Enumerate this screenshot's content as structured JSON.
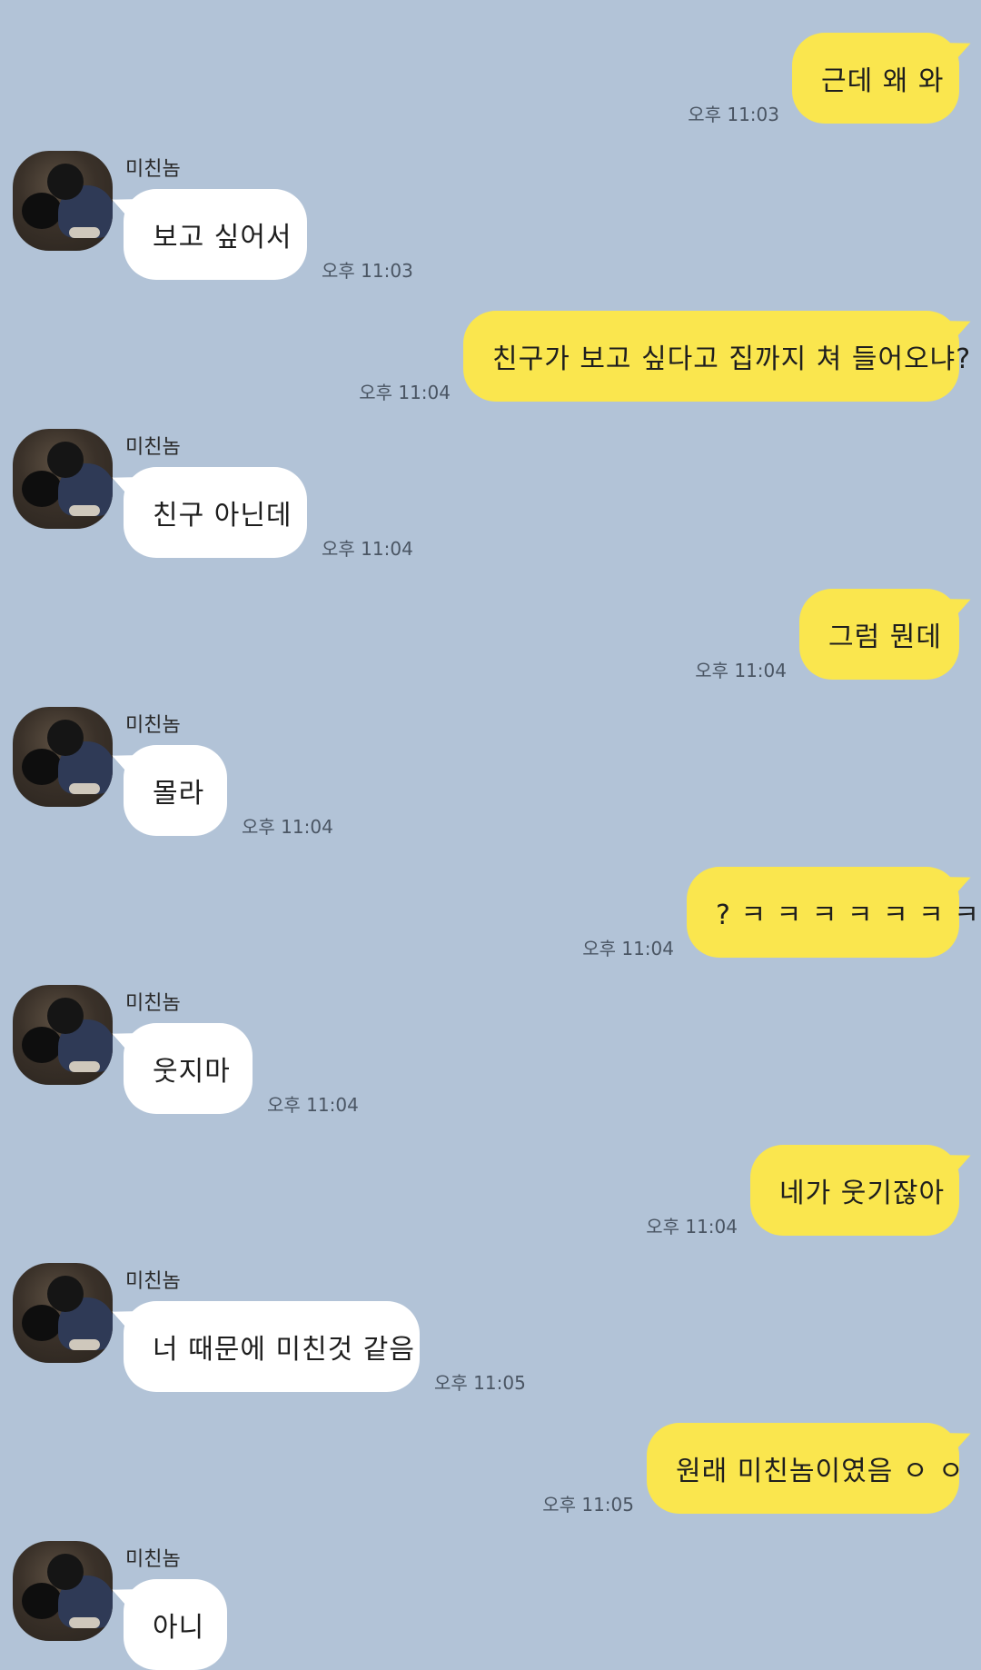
{
  "contact": {
    "name": "미친놈"
  },
  "messages": [
    {
      "from": "me",
      "text": "근데 왜 와",
      "time": "오후 11:03"
    },
    {
      "from": "friend",
      "text": "보고 싶어서",
      "time": "오후 11:03"
    },
    {
      "from": "me",
      "text": "친구가 보고 싶다고 집까지 쳐 들어오냐?",
      "time": "오후 11:04"
    },
    {
      "from": "friend",
      "text": "친구 아닌데",
      "time": "오후 11:04"
    },
    {
      "from": "me",
      "text": "그럼 뭔데",
      "time": "오후 11:04"
    },
    {
      "from": "friend",
      "text": "몰라",
      "time": "오후 11:04"
    },
    {
      "from": "me",
      "text": "? ㅋ ㅋ ㅋ ㅋ ㅋ ㅋ ㅋ",
      "time": "오후 11:04"
    },
    {
      "from": "friend",
      "text": "웃지마",
      "time": "오후 11:04"
    },
    {
      "from": "me",
      "text": "네가 웃기잖아",
      "time": "오후 11:04"
    },
    {
      "from": "friend",
      "text": "너 때문에 미친것 같음",
      "time": "오후 11:05"
    },
    {
      "from": "me",
      "text": "원래 미친놈이였음 ㅇ ㅇ",
      "time": "오후 11:05"
    },
    {
      "from": "friend",
      "text": "아니",
      "time": ""
    }
  ]
}
